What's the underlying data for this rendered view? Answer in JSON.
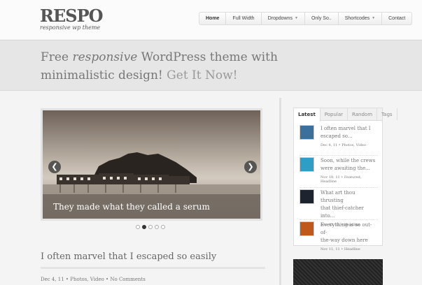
{
  "logo": {
    "name": "RESPO",
    "tagline": "responsive wp theme"
  },
  "nav": {
    "items": [
      {
        "label": "Home",
        "active": true,
        "dropdown": false
      },
      {
        "label": "Full Width",
        "active": false,
        "dropdown": false
      },
      {
        "label": "Dropdowns",
        "active": false,
        "dropdown": true
      },
      {
        "label": "Only So..",
        "active": false,
        "dropdown": false
      },
      {
        "label": "Shortcodes",
        "active": false,
        "dropdown": true
      },
      {
        "label": "Contact",
        "active": false,
        "dropdown": false
      }
    ]
  },
  "banner": {
    "prefix": "Free ",
    "emphasis": "responsive",
    "suffix": " WordPress theme with",
    "line2": "minimalistic design! ",
    "cta": "Get It Now!"
  },
  "slider": {
    "caption": "They made what they called a serum",
    "prev_icon": "chevron-left-icon",
    "next_icon": "chevron-right-icon",
    "dot_count": 5,
    "active_dot": 2
  },
  "post": {
    "title": "I often marvel that I escaped so easily",
    "meta": "Dec 4, 11 • Photos, Video • No Comments"
  },
  "sidebar": {
    "tabs": [
      "Latest",
      "Popular",
      "Random",
      "Tags"
    ],
    "active_tab": "Latest",
    "posts": [
      {
        "title_l1": "I often marvel that I",
        "title_l2": "escaped so...",
        "meta": "Dec 4, 11 • Photos, Video",
        "thumb_color": "#3b6f9c"
      },
      {
        "title_l1": "Soon, while the crews",
        "title_l2": "were awaiting the...",
        "meta": "Nov 18, 11 • Featured, Headline",
        "thumb_color": "#2f9ec4"
      },
      {
        "title_l1": "What art thou thrusting",
        "title_l2": "that thief-catcher into...",
        "meta": "Nov 12, 11 • Headline",
        "thumb_color": "#1d2430"
      },
      {
        "title_l1": "Everything is so out-of-",
        "title_l2": "the-way down here",
        "meta": "Nov 11, 11 • Headline",
        "thumb_color": "#c0581c"
      }
    ]
  }
}
